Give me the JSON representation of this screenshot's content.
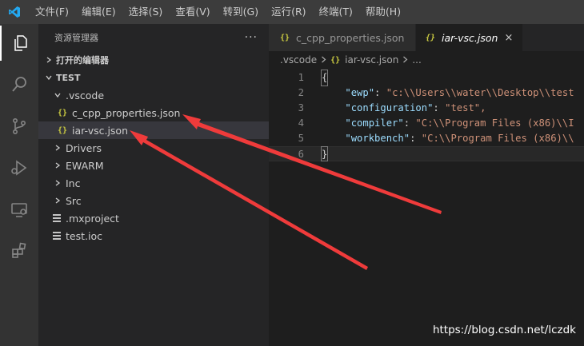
{
  "menubar": {
    "items": [
      "文件(F)",
      "编辑(E)",
      "选择(S)",
      "查看(V)",
      "转到(G)",
      "运行(R)",
      "终端(T)",
      "帮助(H)"
    ]
  },
  "activitybar": {
    "icons": [
      "explorer-icon",
      "search-icon",
      "source-control-icon",
      "run-debug-icon",
      "remote-explorer-icon",
      "extensions-icon"
    ]
  },
  "sidebar": {
    "title": "资源管理器",
    "more": "···",
    "open_editors": "打开的编辑器",
    "project": "TEST",
    "tree": [
      {
        "label": ".vscode",
        "type": "folder-open"
      },
      {
        "label": "c_cpp_properties.json",
        "type": "json"
      },
      {
        "label": "iar-vsc.json",
        "type": "json"
      },
      {
        "label": "Drivers",
        "type": "folder"
      },
      {
        "label": "EWARM",
        "type": "folder"
      },
      {
        "label": "Inc",
        "type": "folder"
      },
      {
        "label": "Src",
        "type": "folder"
      },
      {
        "label": ".mxproject",
        "type": "file"
      },
      {
        "label": "test.ioc",
        "type": "file"
      }
    ]
  },
  "editor": {
    "tabs": [
      {
        "label": "c_cpp_properties.json",
        "active": false
      },
      {
        "label": "iar-vsc.json",
        "active": true
      }
    ],
    "tab_close": "×",
    "json_icon": "{}",
    "breadcrumb": {
      "folder": ".vscode",
      "file": "iar-vsc.json",
      "tail": "..."
    },
    "lines": [
      {
        "num": "1",
        "text": "{"
      },
      {
        "num": "2",
        "key": "\"ewp\"",
        "value": "\"c:\\\\Users\\\\water\\\\Desktop\\\\test"
      },
      {
        "num": "3",
        "key": "\"configuration\"",
        "value": "\"test\","
      },
      {
        "num": "4",
        "key": "\"compiler\"",
        "value": "\"C:\\\\Program Files (x86)\\\\I"
      },
      {
        "num": "5",
        "key": "\"workbench\"",
        "value": "\"C:\\\\Program Files (x86)\\\\"
      },
      {
        "num": "6",
        "text": "}"
      }
    ]
  },
  "colors": {
    "accent_arrow": "#ef3b3b",
    "json_icon": "#cbcb41",
    "key": "#9cdcfe",
    "string": "#ce9178"
  },
  "watermark": "https://blog.csdn.net/lczdk"
}
